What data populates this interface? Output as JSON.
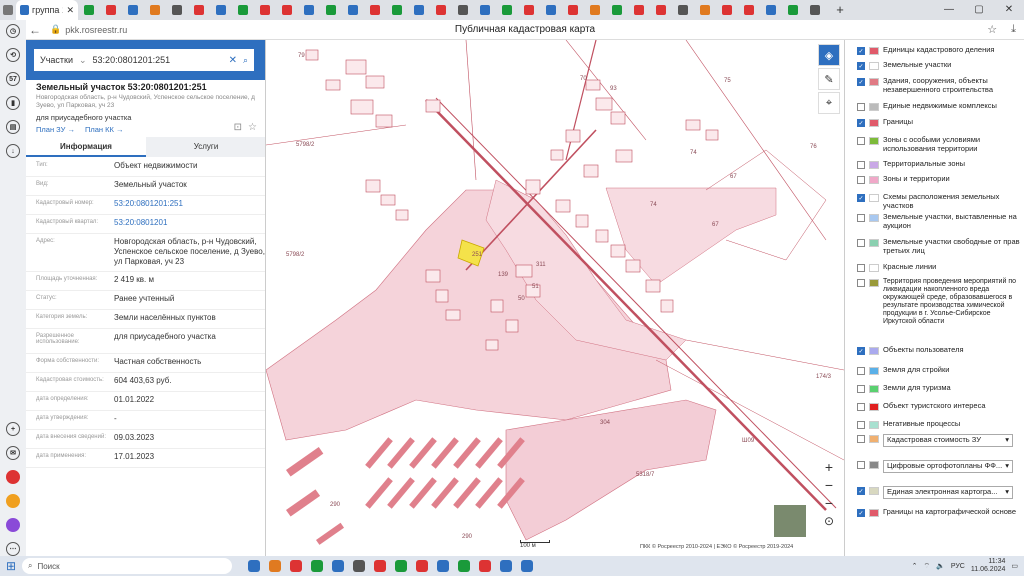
{
  "browser": {
    "active_tab_title": "группа 1",
    "url": "pkk.rosreestr.ru",
    "page_title": "Публичная кадастровая карта"
  },
  "search": {
    "type": "Участки",
    "query": "53:20:0801201:251"
  },
  "parcel": {
    "title": "Земельный участок 53:20:0801201:251",
    "address_small": "Новгородская область, р-н Чудовский, Успенское сельское поселение, д Зуево, ул Парковая, уч 23",
    "purpose": "для приусадебного участка",
    "plan_zu": "План ЗУ →",
    "plan_kk": "План КК →"
  },
  "tabs": {
    "info": "Информация",
    "services": "Услуги"
  },
  "rows": [
    {
      "k": "Тип:",
      "v": "Объект недвижимости",
      "link": false
    },
    {
      "k": "Вид:",
      "v": "Земельный участок",
      "link": false
    },
    {
      "k": "Кадастровый номер:",
      "v": "53:20:0801201:251",
      "link": true
    },
    {
      "k": "Кадастровый квартал:",
      "v": "53:20:0801201",
      "link": true
    },
    {
      "k": "Адрес:",
      "v": "Новгородская область, р-н Чудовский, Успенское сельское поселение, д Зуево, ул Парковая, уч 23",
      "link": false
    },
    {
      "k": "Площадь уточненная:",
      "v": "2 419 кв. м",
      "link": false
    },
    {
      "k": "Статус:",
      "v": "Ранее учтенный",
      "link": false
    },
    {
      "k": "Категория земель:",
      "v": "Земли населённых пунктов",
      "link": false
    },
    {
      "k": "Разрешенное использование:",
      "v": "для приусадебного участка",
      "link": false
    },
    {
      "k": "Форма собственности:",
      "v": "Частная собственность",
      "link": false
    },
    {
      "k": "Кадастровая стоимость:",
      "v": "604 403,63 руб.",
      "link": false
    },
    {
      "k": "дата определения:",
      "v": "01.01.2022",
      "link": false
    },
    {
      "k": "дата утверждения:",
      "v": "-",
      "link": false
    },
    {
      "k": "дата внесения сведений:",
      "v": "09.03.2023",
      "link": false
    },
    {
      "k": "дата применения:",
      "v": "17.01.2023",
      "link": false
    }
  ],
  "map_labels": [
    "79",
    "5798/2",
    "5798/2",
    "74",
    "67",
    "74",
    "67",
    "76",
    "75",
    "174/3",
    "304",
    "5318/7",
    "290",
    "290",
    "Ш09",
    "251",
    "139",
    "311",
    "50",
    "51",
    "70",
    "93"
  ],
  "layers": [
    {
      "label": "Единицы кадастрового деления",
      "on": true,
      "color": "#e05a6a"
    },
    {
      "label": "Земельные участки",
      "on": true,
      "color": "#ffffff"
    },
    {
      "label": "Здания, сооружения, объекты незавершенного строительства",
      "on": true,
      "color": "#e07a84"
    },
    {
      "label": "Единые недвижимые комплексы",
      "on": false,
      "color": "#bbbbbb"
    },
    {
      "label": "Границы",
      "on": true,
      "color": "#e05a6a"
    },
    {
      "label": "Зоны с особыми условиями использования территории",
      "on": false,
      "color": "#7dbb3a"
    },
    {
      "label": "Территориальные зоны",
      "on": false,
      "color": "#c9a8e6"
    },
    {
      "label": "Зоны и территории",
      "on": false,
      "color": "#f0a8c8"
    },
    {
      "label": "Схемы расположения земельных участков",
      "on": true,
      "color": "#ffffff"
    },
    {
      "label": "Земельные участки, выставленные на аукцион",
      "on": false,
      "color": "#a8c8f0"
    },
    {
      "label": "Земельные участки свободные от прав третьих лиц",
      "on": false,
      "color": "#8ad0b0"
    },
    {
      "label": "Красные линии",
      "on": false,
      "color": "#ffffff"
    },
    {
      "label": "Территория проведения мероприятий по ликвидации накопленного вреда окружающей среде, образовавшегося в результате производства химической продукции в г. Усолье-Сибирское Иркутской области",
      "on": false,
      "color": "#9a9a3a"
    },
    {
      "label": "Объекты пользователя",
      "on": true,
      "color": "#aaaaee"
    },
    {
      "label": "Земля для стройки",
      "on": false,
      "color": "#5ab0e8"
    },
    {
      "label": "Земли для туризма",
      "on": false,
      "color": "#5ad070"
    },
    {
      "label": "Объект туристского интереса",
      "on": false,
      "color": "#e02020"
    },
    {
      "label": "Негативные процессы",
      "on": false,
      "color": "#a8e0d0"
    },
    {
      "label": "Кадастровая стоимость ЗУ",
      "on": false,
      "color": "#f0b070",
      "select": true
    },
    {
      "label": "Цифровые ортофотопланы ФФ...",
      "on": false,
      "color": "#888888",
      "select": true
    },
    {
      "label": "Единая электронная картогра...",
      "on": true,
      "color": "#d8d8c0",
      "select": true
    },
    {
      "label": "Границы на картографической основе",
      "on": true,
      "color": "#e05a6a"
    }
  ],
  "map": {
    "scale": "100 м",
    "copyright": "ПКК © Росреестр 2010-2024 | ЕЭКО © Росреестр 2019-2024"
  },
  "taskbar": {
    "search_placeholder": "Поиск",
    "lang": "РУС",
    "time": "11:34",
    "date": "11.06.2024"
  }
}
